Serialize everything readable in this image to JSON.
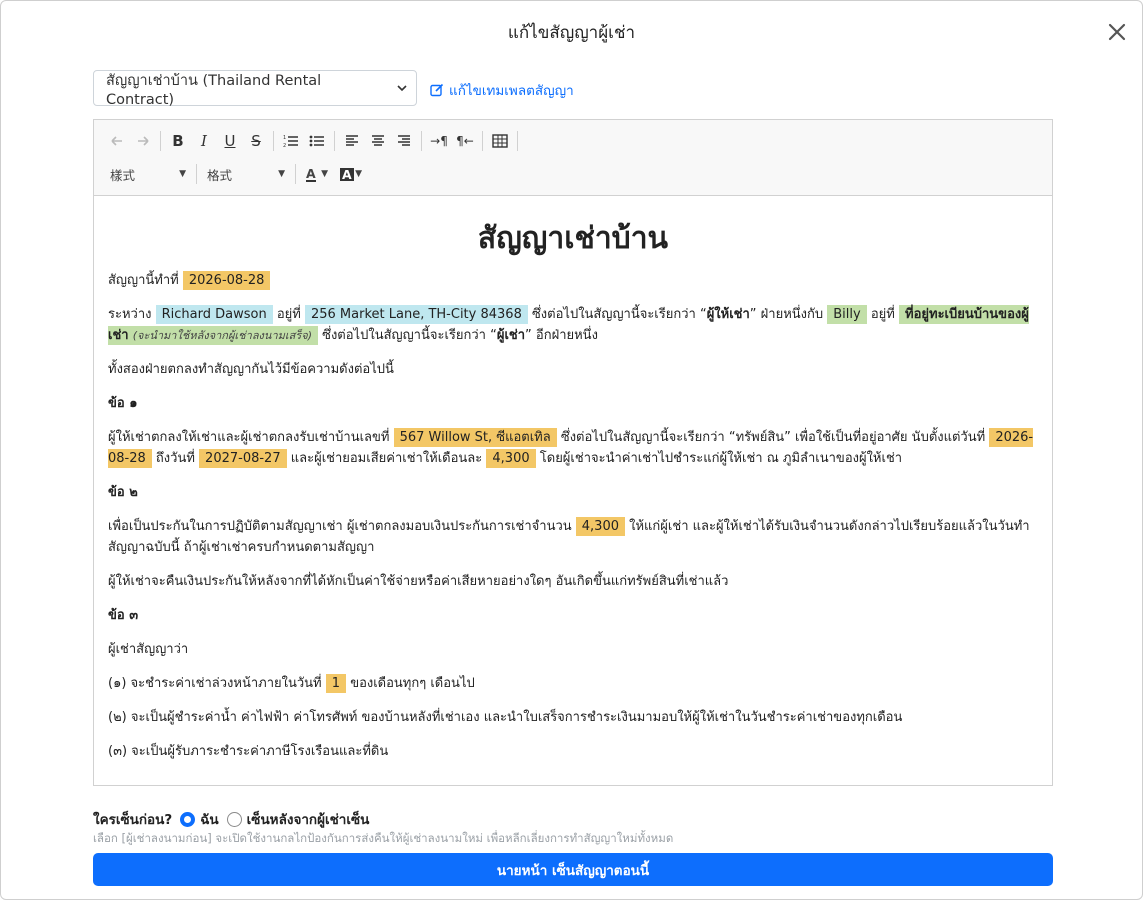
{
  "modal": {
    "title": "แก้ไขสัญญาผู้เช่า",
    "close_label": "×"
  },
  "template": {
    "selected": "สัญญาเช่าบ้าน (Thailand Rental Contract)",
    "edit_link": "แก้ไขเทมเพลตสัญญา"
  },
  "toolbar": {
    "style_combo": "樣式",
    "format_combo": "格式",
    "text_color_label": "A",
    "bg_color_label": "A"
  },
  "doc": {
    "title": "สัญญาเช่าบ้าน",
    "l1_pre": "สัญญานี้ทำที่",
    "contract_date": "2026-08-28",
    "l2_between": "ระหว่าง",
    "landlord_name": "Richard Dawson",
    "l2_at": "อยู่ที่",
    "landlord_address": "256 Market Lane, TH-City 84368",
    "l2_called_landlord_pre": "ซึ่งต่อไปในสัญญานี้จะเรียกว่า “",
    "landlord_role": "ผู้ให้เช่า",
    "l2_called_landlord_post": "” ฝ่ายหนึ่งกับ",
    "tenant_name": "Billy",
    "l2_at2": "อยู่ที่",
    "tenant_address": "ที่อยู่ทะเบียนบ้านของผู้เช่า",
    "tenant_address_note": "(จะนำมาใช้หลังจากผู้เช่าลงนามเสร็จ)",
    "l2_called_tenant_pre": "ซึ่งต่อไปในสัญญานี้จะเรียกว่า “",
    "tenant_role": "ผู้เช่า",
    "l2_called_tenant_post": "” อีกฝ่ายหนึ่ง",
    "l3": "ทั้งสองฝ่ายตกลงทำสัญญากันไว้มีข้อความดังต่อไปนี้",
    "clause1_heading": "ข้อ ๑",
    "c1_pre": "ผู้ให้เช่าตกลงให้เช่าและผู้เช่าตกลงรับเช่าบ้านเลขที่",
    "property_address": "567 Willow St, ซีแอตเทิล",
    "c1_mid": "ซึ่งต่อไปในสัญญานี้จะเรียกว่า “ทรัพย์สิน” เพื่อใช้เป็นที่อยู่อาศัย นับตั้งแต่วันที่",
    "start_date": "2026-08-28",
    "c1_until": "ถึงวันที่",
    "end_date": "2027-08-27",
    "c1_rent_pre": "และผู้เช่ายอมเสียค่าเช่าให้เดือนละ",
    "monthly_rent": "4,300",
    "c1_rent_post": "โดยผู้เช่าจะนำค่าเช่าไปชำระแก่ผู้ให้เช่า ณ ภูมิลำเนาของผู้ให้เช่า",
    "clause2_heading": "ข้อ ๒",
    "c2_pre": "เพื่อเป็นประกันในการปฏิบัติตามสัญญาเช่า ผู้เช่าตกลงมอบเงินประกันการเช่าจำนวน",
    "deposit": "4,300",
    "c2_post": "ให้แก่ผู้เช่า และผู้ให้เช่าได้รับเงินจำนวนดังกล่าวไปเรียบร้อยแล้วในวันทำสัญญาฉบับนี้ ถ้าผู้เช่าเช่าครบกำหนดตามสัญญา",
    "c2_refund": "ผู้ให้เช่าจะคืนเงินประกันให้หลังจากที่ได้หักเป็นค่าใช้จ่ายหรือค่าเสียหายอย่างใดๆ อันเกิดขึ้นแก่ทรัพย์สินที่เช่าแล้ว",
    "clause3_heading": "ข้อ ๓",
    "c3_intro": "ผู้เช่าสัญญาว่า",
    "c3_1_pre": "(๑) จะชำระค่าเช่าล่วงหน้าภายในวันที่",
    "pay_day": "1",
    "c3_1_post": "ของเดือนทุกๆ เดือนไป",
    "c3_2": "(๒) จะเป็นผู้ชำระค่าน้ำ ค่าไฟฟ้า ค่าโทรศัพท์ ของบ้านหลังที่เช่าเอง และนำใบเสร็จการชำระเงินมามอบให้ผู้ให้เช่าในวันชำระค่าเช่าของทุกเดือน",
    "c3_3": "(๓) จะเป็นผู้รับภาระชำระค่าภาษีโรงเรือนและที่ดิน"
  },
  "signing": {
    "question": "ใครเซ็นก่อน?",
    "opt_me": "ฉัน",
    "opt_after": "เซ็นหลังจากผู้เช่าเซ็น",
    "hint": "เลือก [ผู้เช่าลงนามก่อน] จะเปิดใช้งานกลไกป้องกันการส่งคืนให้ผู้เช่าลงนามใหม่ เพื่อหลีกเลี่ยงการทำสัญญาใหม่ทั้งหมด",
    "submit": "นายหน้า เซ็นสัญญาตอนนี้"
  }
}
